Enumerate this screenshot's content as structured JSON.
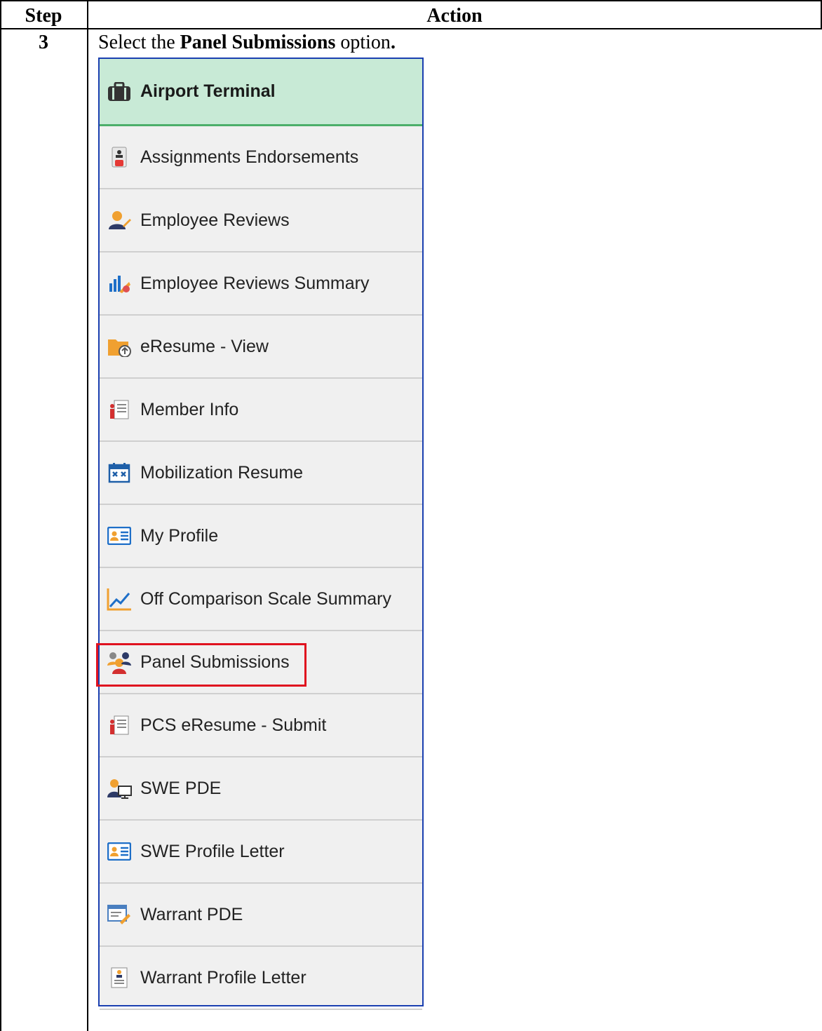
{
  "table": {
    "col_step": "Step",
    "col_action": "Action",
    "step_number": "3",
    "instruction_prefix": "Select the ",
    "instruction_bold": "Panel Submissions",
    "instruction_suffix": " option",
    "instruction_end": "."
  },
  "menu": {
    "header": {
      "label": "Airport Terminal",
      "icon": "briefcase-icon"
    },
    "items": [
      {
        "label": "Assignments Endorsements",
        "icon": "assignments-icon"
      },
      {
        "label": "Employee Reviews",
        "icon": "user-edit-icon"
      },
      {
        "label": "Employee Reviews Summary",
        "icon": "bar-chart-icon"
      },
      {
        "label": "eResume - View",
        "icon": "folder-upload-icon"
      },
      {
        "label": "Member Info",
        "icon": "member-list-icon"
      },
      {
        "label": "Mobilization Resume",
        "icon": "calendar-icon"
      },
      {
        "label": "My Profile",
        "icon": "profile-card-icon"
      },
      {
        "label": "Off Comparison Scale Summary",
        "icon": "line-chart-icon"
      },
      {
        "label": "Panel Submissions",
        "icon": "panel-people-icon",
        "highlighted": true
      },
      {
        "label": "PCS eResume - Submit",
        "icon": "member-list-icon"
      },
      {
        "label": "SWE PDE",
        "icon": "user-computer-icon"
      },
      {
        "label": "SWE Profile Letter",
        "icon": "profile-card-icon"
      },
      {
        "label": "Warrant PDE",
        "icon": "document-edit-icon"
      },
      {
        "label": "Warrant Profile Letter",
        "icon": "profile-letter-icon"
      }
    ]
  },
  "colors": {
    "highlight": "#e0121f",
    "header_bg": "#c8ead6",
    "menu_border": "#1a3fb0"
  }
}
